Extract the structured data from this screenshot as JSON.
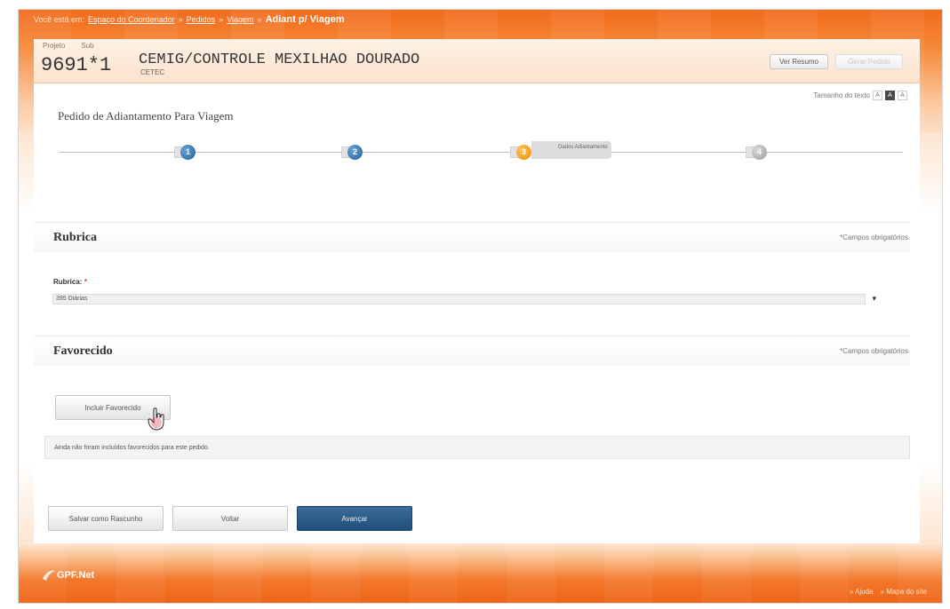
{
  "breadcrumb": {
    "prefix": "Você está em:",
    "items": [
      "Espaço do Coordenador",
      "Pedidos",
      "Viagem"
    ],
    "separator": "»",
    "current": "Adiant p/ Viagem"
  },
  "project": {
    "project_label": "Projeto",
    "sub_label": "Sub",
    "number": "9691*1",
    "name": "CEMIG/CONTROLE MEXILHAO DOURADO",
    "org": "CETEC"
  },
  "header_buttons": {
    "summary": "Ver Resumo",
    "other": "Gerar Pedido"
  },
  "text_size": {
    "label": "Tamanho do texto",
    "options": [
      "A",
      "A",
      "A"
    ]
  },
  "page_title": "Pedido de Adiantamento Para Viagem",
  "steps": [
    {
      "number": "1",
      "state": "done"
    },
    {
      "number": "2",
      "state": "done"
    },
    {
      "number": "3",
      "state": "current",
      "label": "Dados Adiantamento"
    },
    {
      "number": "4",
      "state": "pending"
    }
  ],
  "rubrica_section": {
    "title": "Rubrica",
    "required_note": "*Campos obrigatórios",
    "field_label": "Rubrica:",
    "required_mark": "*",
    "selected_value": "395 Diárias"
  },
  "favorecido_section": {
    "title": "Favorecido",
    "required_note": "*Campos obrigatórios",
    "add_button": "Incluir Favorecido",
    "empty_message": "Ainda não foram incluídos favorecidos para este pedido."
  },
  "actions": {
    "save_draft": "Salvar como Rascunho",
    "back": "Voltar",
    "next": "Avançar"
  },
  "footer": {
    "logo": "GPF.Net",
    "links": [
      "» Ajuda",
      "» Mapa do site"
    ]
  },
  "colors": {
    "brand_orange": "#f26a1b",
    "step_done": "#1f5f9e",
    "step_current": "#f28a00",
    "primary_button": "#214f79"
  }
}
